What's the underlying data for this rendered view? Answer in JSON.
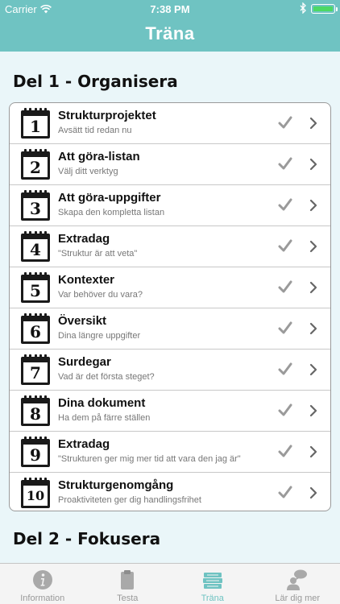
{
  "status_bar": {
    "carrier": "Carrier",
    "time": "7:38 PM"
  },
  "nav": {
    "title": "Träna"
  },
  "sections": [
    {
      "title": "Del 1 - Organisera"
    },
    {
      "title": "Del 2 - Fokusera"
    }
  ],
  "items": [
    {
      "number": "1",
      "title": "Strukturprojektet",
      "subtitle": "Avsätt tid redan nu"
    },
    {
      "number": "2",
      "title": "Att göra-listan",
      "subtitle": "Välj ditt verktyg"
    },
    {
      "number": "3",
      "title": "Att göra-uppgifter",
      "subtitle": "Skapa den kompletta listan"
    },
    {
      "number": "4",
      "title": "Extradag",
      "subtitle": "\"Struktur är att veta\""
    },
    {
      "number": "5",
      "title": "Kontexter",
      "subtitle": "Var behöver du vara?"
    },
    {
      "number": "6",
      "title": "Översikt",
      "subtitle": "Dina längre uppgifter"
    },
    {
      "number": "7",
      "title": "Surdegar",
      "subtitle": "Vad är det första steget?"
    },
    {
      "number": "8",
      "title": "Dina dokument",
      "subtitle": "Ha dem på färre ställen"
    },
    {
      "number": "9",
      "title": "Extradag",
      "subtitle": " \"Strukturen ger mig mer tid att vara den jag är\""
    },
    {
      "number": "10",
      "title": "Strukturgenomgång",
      "subtitle": "Proaktiviteten ger dig handlingsfrihet"
    }
  ],
  "tabs": [
    {
      "label": "Information",
      "icon": "info-icon"
    },
    {
      "label": "Testa",
      "icon": "clipboard-icon"
    },
    {
      "label": "Träna",
      "icon": "stack-icon",
      "active": true
    },
    {
      "label": "Lär dig mer",
      "icon": "chat-person-icon"
    }
  ],
  "colors": {
    "accent": "#6fc3c2",
    "background": "#eaf6f9"
  }
}
